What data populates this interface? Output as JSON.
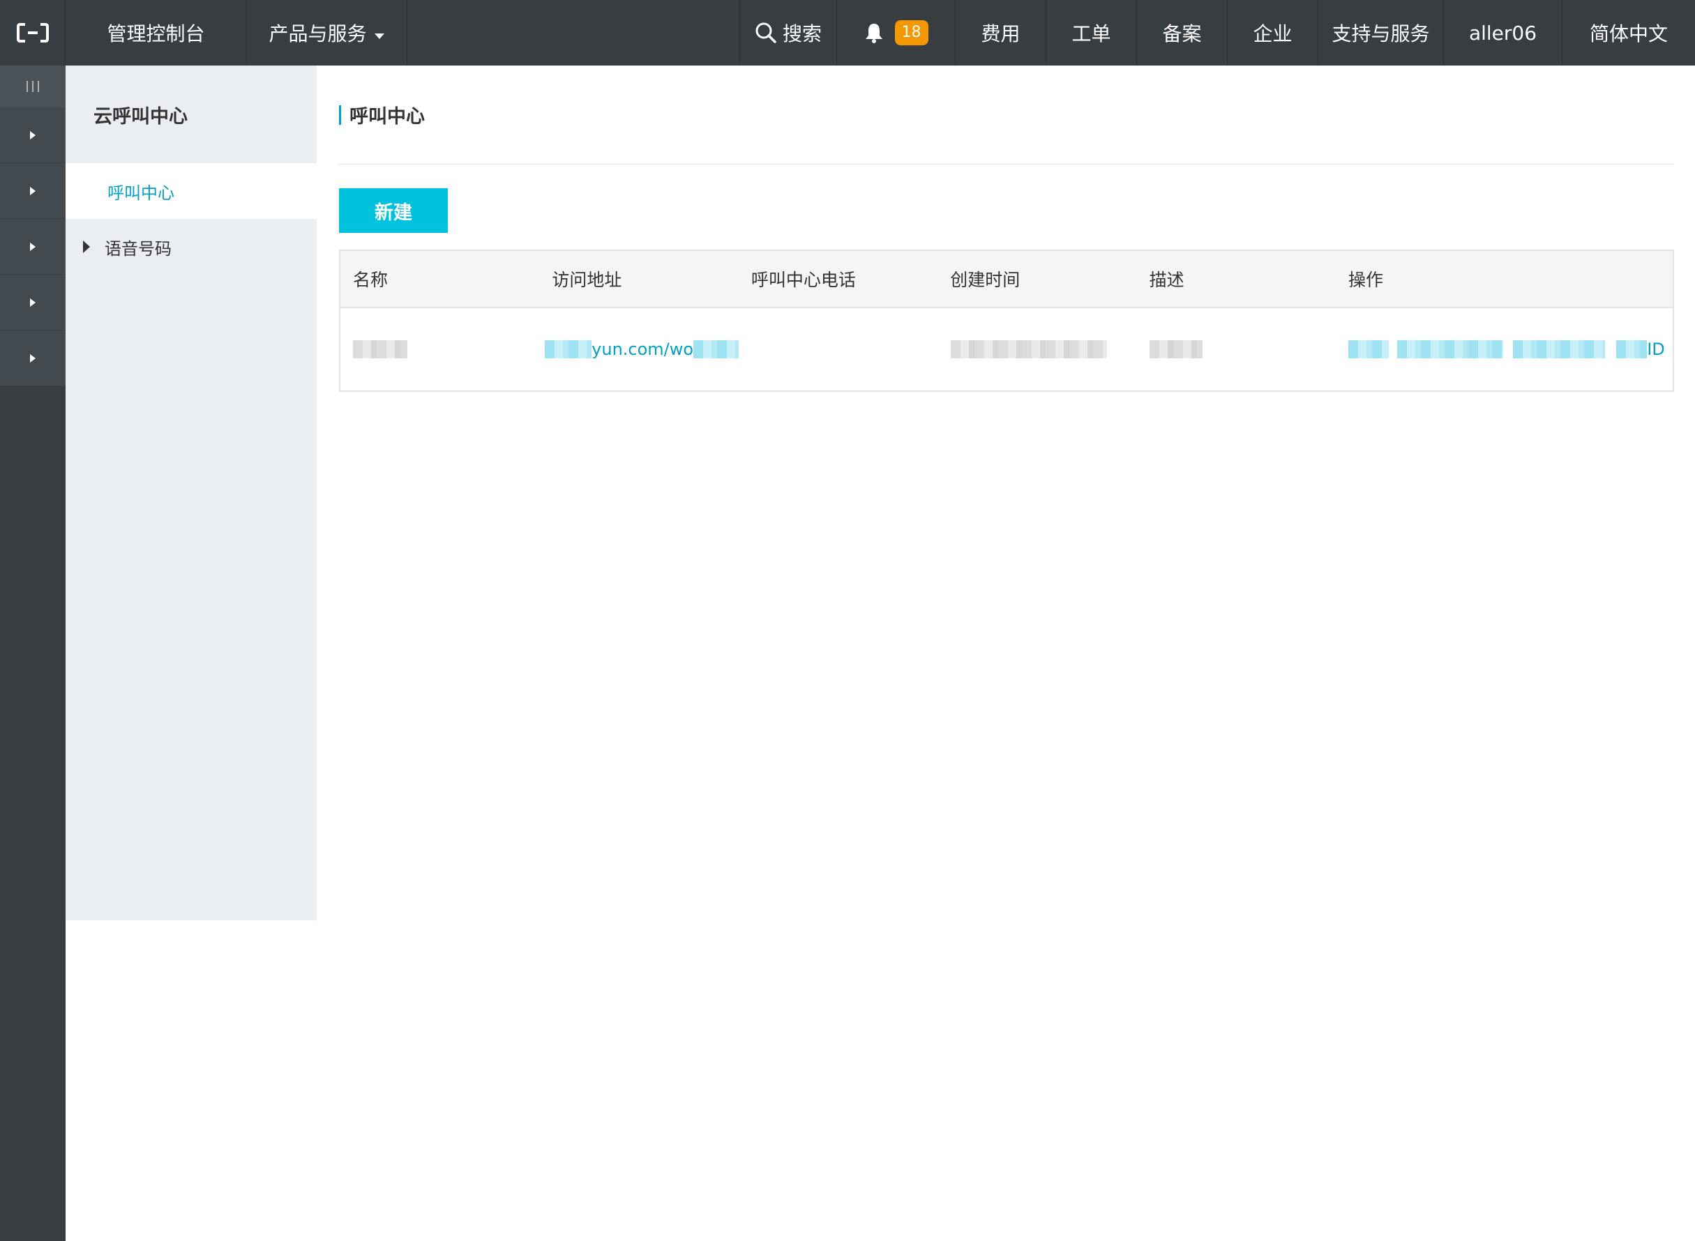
{
  "topbar": {
    "console_label": "管理控制台",
    "products_label": "产品与服务",
    "search_label": "搜索",
    "notification_count": "18",
    "nav": [
      "费用",
      "工单",
      "备案",
      "企业",
      "支持与服务",
      "aller06",
      "简体中文"
    ]
  },
  "sidebar": {
    "title": "云呼叫中心",
    "items": [
      {
        "label": "呼叫中心"
      },
      {
        "label": "语音号码"
      }
    ]
  },
  "main": {
    "title": "呼叫中心",
    "new_button": "新建",
    "table": {
      "columns": [
        "名称",
        "访问地址",
        "呼叫中心电话",
        "创建时间",
        "描述",
        "操作"
      ],
      "rows": [
        {
          "url_visible": "yun.com/wo",
          "ops_visible": "ID"
        }
      ]
    }
  },
  "colors": {
    "topbar_bg": "#373d41",
    "accent": "#00c1de",
    "link": "#00a2ca",
    "badge": "#f39800"
  }
}
